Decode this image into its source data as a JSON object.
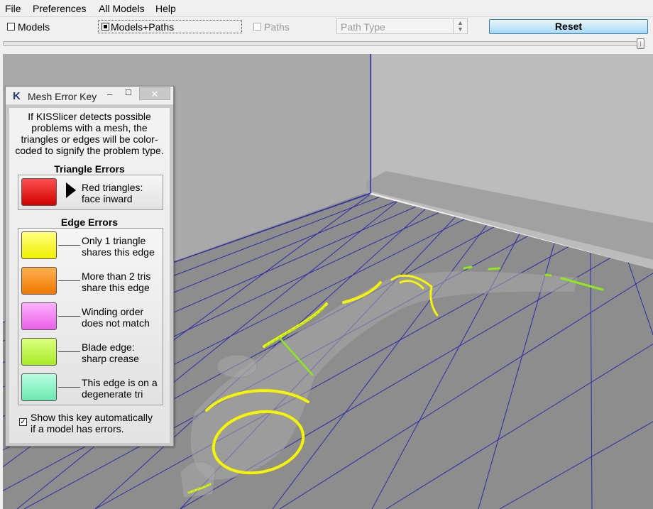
{
  "menu": [
    "File",
    "Preferences",
    "All Models",
    "Help"
  ],
  "toolbar": {
    "models_label": "Models",
    "models_paths_label": "Models+Paths",
    "paths_label": "Paths",
    "path_type_placeholder": "Path Type",
    "reset_label": "Reset"
  },
  "dialog": {
    "title": "Mesh Error Key",
    "logo": "K",
    "minimize": "–",
    "maximize": "☐",
    "close": "✕",
    "intro_lines": [
      "If KISSlicer detects possible",
      "problems with a mesh, the",
      "triangles or edges will be color-",
      "coded to signify the problem type."
    ],
    "triangle_title": "Triangle Errors",
    "triangle_items": [
      {
        "lines": [
          "Red triangles:",
          "face inward"
        ],
        "color": "#e81010"
      }
    ],
    "edge_title": "Edge Errors",
    "edge_items": [
      {
        "lines": [
          "Only 1 triangle",
          "shares this edge"
        ],
        "color": "#f2f20a"
      },
      {
        "lines": [
          "More than 2 tris",
          "share this edge"
        ],
        "color": "#f58a12"
      },
      {
        "lines": [
          "Winding order",
          "does not match"
        ],
        "color": "#f07ef0"
      },
      {
        "lines": [
          "Blade edge:",
          "sharp crease"
        ],
        "color": "#b6f23c"
      },
      {
        "lines": [
          "This edge is on a",
          "degenerate tri"
        ],
        "color": "#7cf2bc"
      }
    ],
    "show_key_lines": [
      "Show this key automatically",
      "if a model has errors."
    ],
    "show_key_checked": "✓"
  },
  "colors": {
    "grid": "#2020a0",
    "floor": "#8a8a8a",
    "back_wall": "#b8b8b8",
    "left_wall": "#a4a4a4",
    "error_yellow": "#f5f500",
    "error_green": "#8fe81c"
  },
  "icons": [
    "kisslicer-logo-icon",
    "minimize-icon",
    "maximize-icon",
    "close-icon",
    "spinner-arrows-icon",
    "triangle-arrow-icon",
    "checkbox-icon"
  ]
}
